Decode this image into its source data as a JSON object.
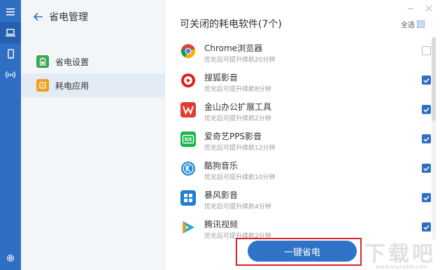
{
  "colors": {
    "primary": "#2f6fc3",
    "sidebar_bg": "#f3f6f9",
    "highlight_border": "#d9262a"
  },
  "rail": {
    "items": [
      {
        "icon": "hamburger-menu-icon"
      },
      {
        "icon": "laptop-icon",
        "active": true
      },
      {
        "icon": "phone-icon"
      },
      {
        "icon": "wireless-broadcast-icon"
      },
      {
        "icon": "gear-icon"
      }
    ]
  },
  "panel": {
    "title": "省电管理",
    "nav": [
      {
        "label": "省电设置",
        "icon": "battery-icon",
        "icon_color": "#3aa655"
      },
      {
        "label": "耗电应用",
        "icon": "power-app-icon",
        "icon_color": "#f0a020",
        "active": true
      }
    ]
  },
  "main": {
    "section_title": "可关闭的耗电软件(7个)",
    "select_all_label": "全选",
    "apps": [
      {
        "name": "Chrome浏览器",
        "desc": "优化后可提升续航20分钟",
        "icon": "chrome-icon",
        "checked": false
      },
      {
        "name": "搜狐影音",
        "desc": "优化后可提升续航8分钟",
        "icon": "sohu-video-icon",
        "checked": true
      },
      {
        "name": "金山办公扩展工具",
        "desc": "优化后可提升续航2分钟",
        "icon": "wps-icon",
        "checked": true
      },
      {
        "name": "爱奇艺PPS影音",
        "desc": "优化后可提升续航12分钟",
        "icon": "iqiyi-icon",
        "checked": true
      },
      {
        "name": "酷狗音乐",
        "desc": "优化后可提升续航10分钟",
        "icon": "kugou-icon",
        "checked": true
      },
      {
        "name": "暴风影音",
        "desc": "优化后可提升续航4分钟",
        "icon": "baofeng-icon",
        "checked": true
      },
      {
        "name": "腾讯视频",
        "desc": "优化后可提升续航2分钟",
        "icon": "tencent-video-icon",
        "checked": true
      }
    ],
    "action_label": "一键省电"
  },
  "watermark": {
    "text": "下载吧",
    "sub": "www.xiazaiba.com"
  }
}
